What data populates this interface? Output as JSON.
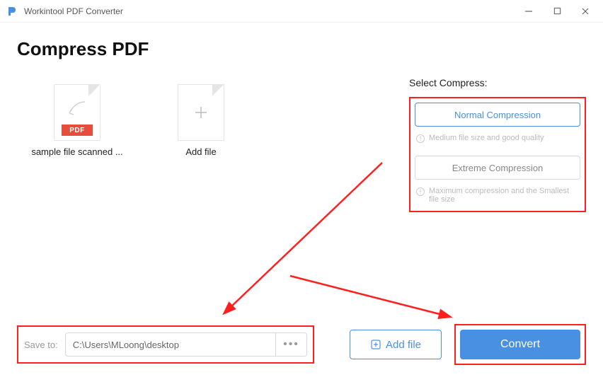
{
  "window": {
    "title": "Workintool PDF Converter"
  },
  "page": {
    "title": "Compress PDF"
  },
  "file": {
    "name": "sample file scanned ...",
    "badge": "PDF"
  },
  "addCard": {
    "label": "Add file"
  },
  "compress": {
    "selectLabel": "Select Compress:",
    "normal": {
      "label": "Normal Compression",
      "hint": "Medium file size and good quality"
    },
    "extreme": {
      "label": "Extreme Compression",
      "hint": "Maximum compression and the Smallest file size"
    }
  },
  "save": {
    "label": "Save to:",
    "path": "C:\\Users\\MLoong\\desktop"
  },
  "buttons": {
    "addFile": "Add file",
    "convert": "Convert"
  },
  "colors": {
    "accent": "#4a90e2",
    "annotation": "#ff1f1f"
  }
}
